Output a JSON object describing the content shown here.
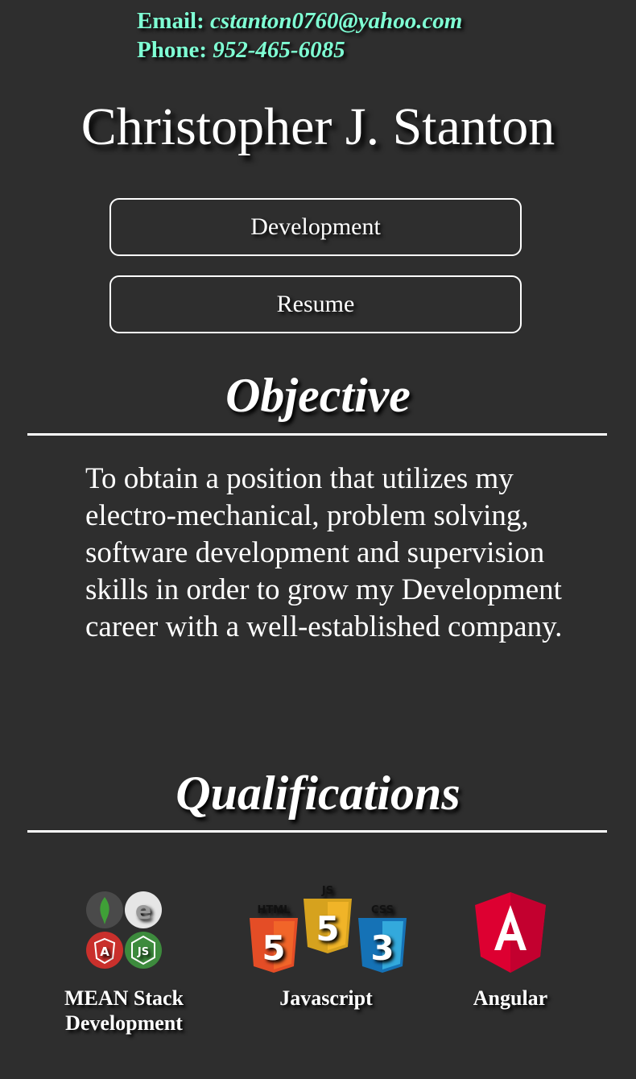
{
  "contact": {
    "email_label": "Email:",
    "email": "cstanton0760@yahoo.com",
    "phone_label": "Phone:",
    "phone": "952-465-6085"
  },
  "name": "Christopher J. Stanton",
  "nav": {
    "development": "Development",
    "resume": "Resume"
  },
  "objective": {
    "title": "Objective",
    "text": "To obtain a position that utilizes my electro-mechanical, problem solving, software development and supervision skills in order to grow my Development career with a well-established company."
  },
  "qualifications": {
    "title": "Qualifications",
    "items": [
      {
        "label": "MEAN Stack Development",
        "icon": "mean-stack-icon"
      },
      {
        "label": "Javascript",
        "icon": "html-js-css-icon"
      },
      {
        "label": "Angular",
        "icon": "angular-icon"
      }
    ]
  },
  "colors": {
    "background": "#2e2e2e",
    "contact": "#7fffd4",
    "text": "#ffffff"
  }
}
